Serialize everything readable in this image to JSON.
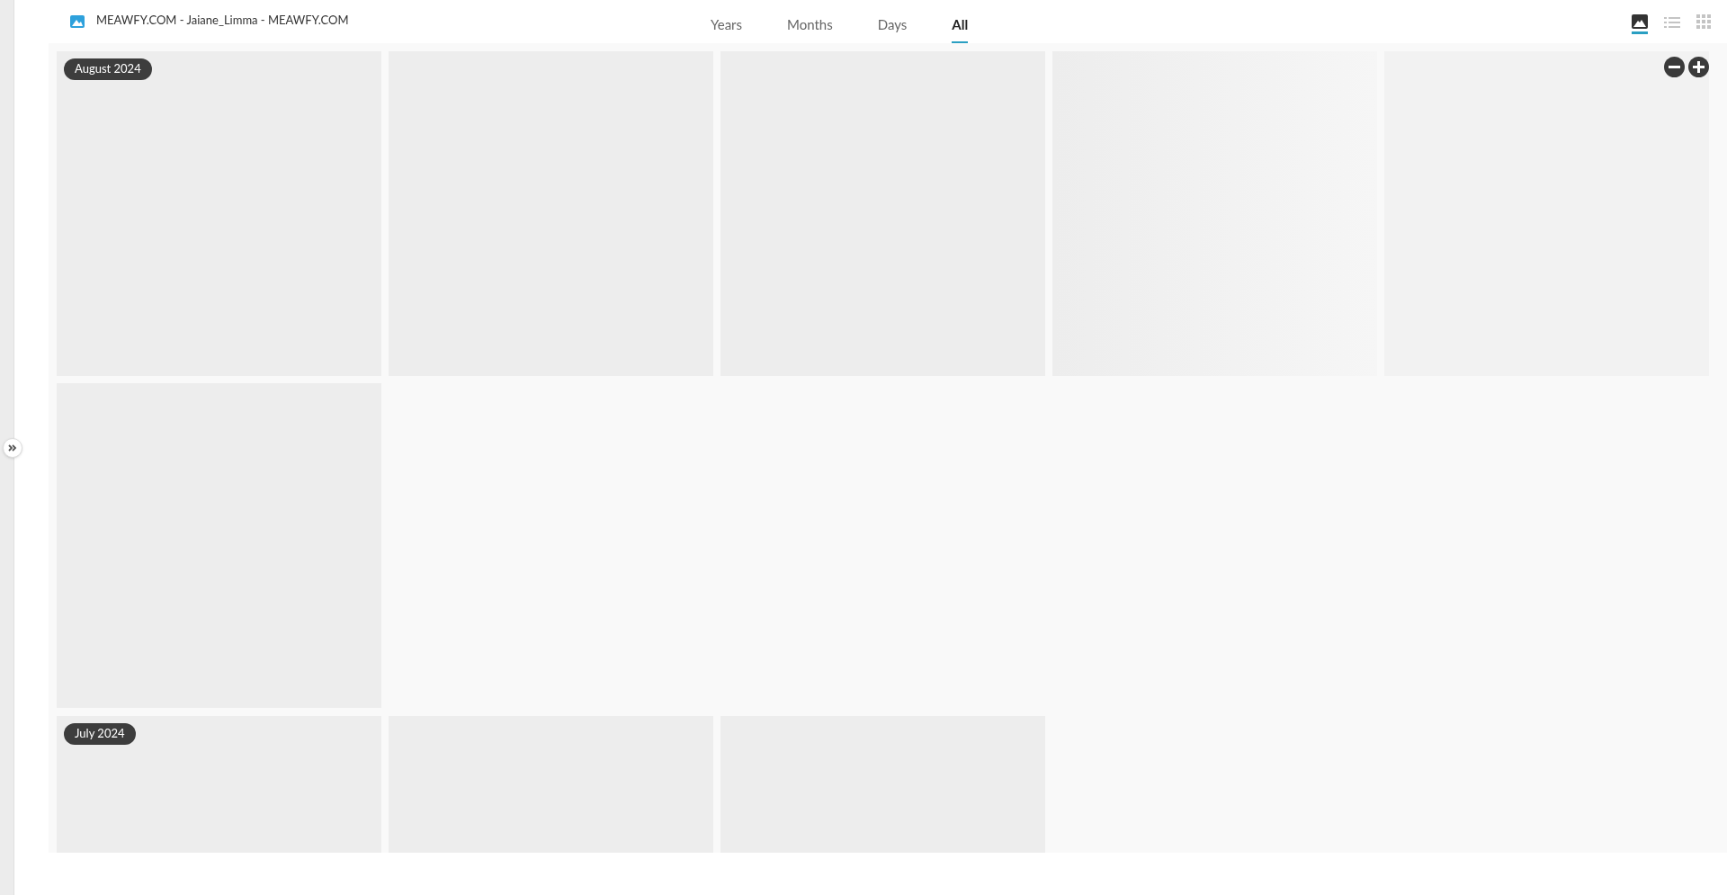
{
  "header": {
    "title": "MEAWFY.COM - Jaiane_Limma - MEAWFY.COM"
  },
  "tabs": [
    {
      "label": "Years",
      "selected": false
    },
    {
      "label": "Months",
      "selected": false
    },
    {
      "label": "Days",
      "selected": false
    },
    {
      "label": "All",
      "selected": true
    }
  ],
  "views": [
    {
      "kind": "photos",
      "selected": true
    },
    {
      "kind": "list",
      "selected": false
    },
    {
      "kind": "grid",
      "selected": false
    }
  ],
  "sections": [
    {
      "label": "August 2024",
      "tiles": [
        {
          "kind": "placeholder"
        },
        {
          "kind": "placeholder"
        },
        {
          "kind": "placeholder"
        },
        {
          "kind": "fading"
        },
        {
          "kind": "faint"
        },
        {
          "kind": "placeholder"
        }
      ]
    },
    {
      "label": "July 2024",
      "tiles": [
        {
          "kind": "placeholder"
        },
        {
          "kind": "placeholder"
        },
        {
          "kind": "placeholder"
        }
      ]
    }
  ]
}
